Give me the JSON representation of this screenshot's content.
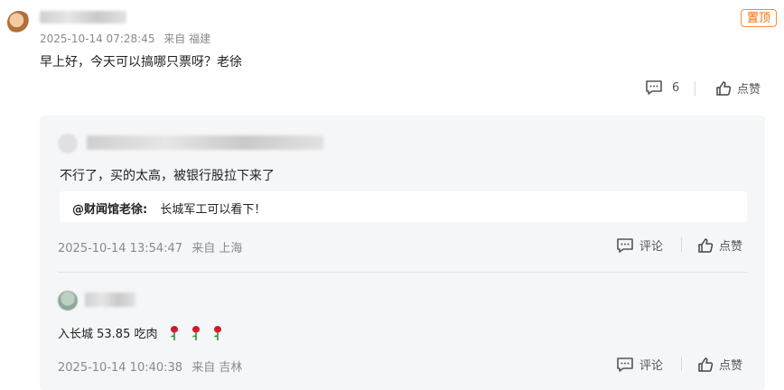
{
  "main_comment": {
    "time": "2025-10-14 07:28:45",
    "location": "来自 福建",
    "pin_badge": "置顶",
    "text": "早上好，今天可以搞哪只票呀？老徐",
    "comment_count": "6",
    "like_label": "点赞"
  },
  "replies": [
    {
      "text": "不行了，买的太高，被银行股拉下来了",
      "quote_user": "@财闻馆老徐:",
      "quote_text": "长城军工可以看下！",
      "time": "2025-10-14 13:54:47",
      "location": "来自 上海",
      "comment_label": "评论",
      "like_label": "点赞"
    },
    {
      "text": "入长城 53.85 吃肉",
      "time": "2025-10-14 10:40:38",
      "location": "来自 吉林",
      "comment_label": "评论",
      "like_label": "点赞"
    }
  ],
  "icons": [
    "comment-icon",
    "thumbs-up-icon",
    "rose-emoji"
  ],
  "colors": {
    "accent": "#ff6a00",
    "meta": "#8a8a8a",
    "reply_bg": "#f5f6f8"
  }
}
